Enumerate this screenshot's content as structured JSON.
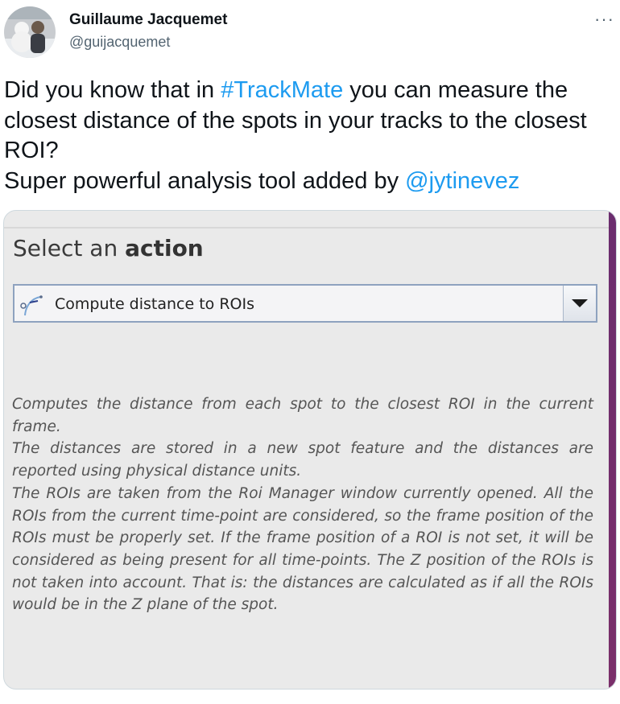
{
  "author": {
    "name": "Guillaume Jacquemet",
    "handle": "@guijacquemet",
    "avatar_icon": "user-avatar-photo"
  },
  "more_label": "···",
  "tweet": {
    "text_1": "Did you know that in ",
    "hashtag": "#TrackMate",
    "text_2": " you can measure the closest distance of the spots in your tracks to the closest ROI?",
    "text_3": "Super powerful analysis tool added by ",
    "mention": "@jytinevez"
  },
  "media": {
    "title_normal": "Select an ",
    "title_bold": "action",
    "combo": {
      "icon": "distance-icon",
      "selected": "Compute distance to ROIs",
      "dropdown_icon": "chevron-down-icon"
    },
    "description": [
      "Computes the distance from each spot to the closest ROI in the current frame.",
      "The distances are stored in a new spot feature and the distances are reported using physical distance units.",
      "The ROIs are taken from the Roi Manager window currently opened. All the ROIs from the current time-point are considered, so the frame position of the ROIs must be properly set. If the frame position of a ROI is not set, it will be considered as being present for all time-points. The Z position of the ROIs is not taken into account. That is: the distances are calculated as if all the ROIs would be in the Z plane of the spot."
    ]
  },
  "colors": {
    "link": "#1d9bf0",
    "accent_stripe": "#6b2d6e",
    "panel_bg": "#eaeaea"
  }
}
